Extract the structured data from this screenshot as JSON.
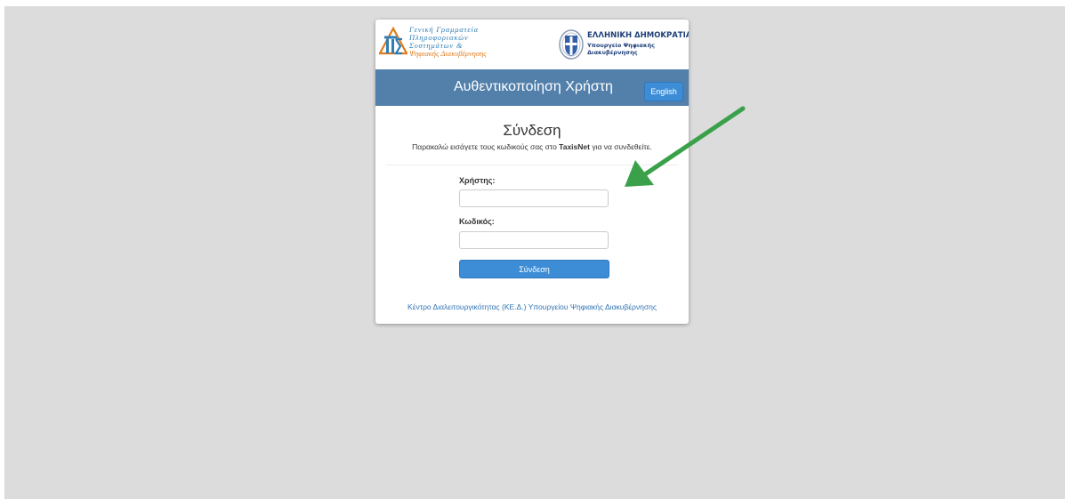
{
  "logos": {
    "gsis_lines": [
      "Γενική Γραμματεία",
      "Πληροφοριακών",
      "Συστημάτων &",
      "Ψηφιακής Διακυβέρνησης"
    ],
    "republic_title": "ΕΛΛΗΝΙΚΗ ΔΗΜΟΚΡΑΤΙΑ",
    "ministry_lines": [
      "Υπουργείο Ψηφιακής",
      "Διακυβέρνησης"
    ]
  },
  "header": {
    "title": "Αυθεντικοποίηση Χρήστη",
    "language_button": "English"
  },
  "login": {
    "heading": "Σύνδεση",
    "instructions_before": "Παρακαλώ εισάγετε τους κωδικούς σας στο ",
    "instructions_bold": "TaxisNet",
    "instructions_after": " για να συνδεθείτε.",
    "username_label": "Χρήστης:",
    "username_value": "",
    "password_label": "Κωδικός:",
    "password_value": "",
    "submit_label": "Σύνδεση"
  },
  "footer": {
    "link_text": "Κέντρο Διαλειτουργικότητας (ΚΕ.Δ.) Υπουργείου Ψηφιακής Διακυβέρνησης"
  },
  "colors": {
    "page_background": "#dcdcdc",
    "header_band": "#5280ab",
    "primary_button": "#3c8dd6",
    "link": "#2f74b5",
    "annotation_arrow": "#3aa14a"
  },
  "icons": {
    "gsis_logo": "gsis-logo-icon",
    "crest": "greek-crest-icon",
    "annotation": "green-arrow-icon"
  }
}
